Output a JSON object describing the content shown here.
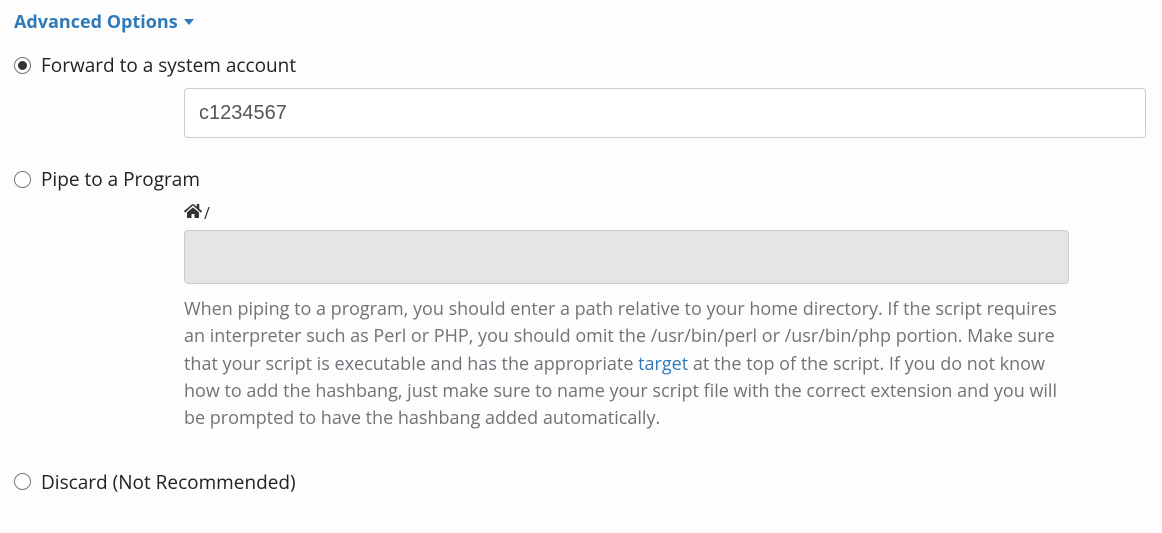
{
  "advanced": {
    "label": "Advanced Options"
  },
  "options": {
    "forward": {
      "label": "Forward to a system account",
      "value": "c1234567",
      "selected": true
    },
    "pipe": {
      "label": "Pipe to a Program",
      "path_suffix": "/",
      "help_pre": "When piping to a program, you should enter a path relative to your home directory. If the script requires an interpreter such as Perl or PHP, you should omit the /usr/bin/perl or /usr/bin/php portion. Make sure that your script is executable and has the appropriate ",
      "help_link": "target",
      "help_post": " at the top of the script. If you do not know how to add the hashbang, just make sure to name your script file with the correct extension and you will be prompted to have the hashbang added automatically.",
      "selected": false
    },
    "discard": {
      "label": "Discard (Not Recommended)",
      "selected": false
    }
  }
}
